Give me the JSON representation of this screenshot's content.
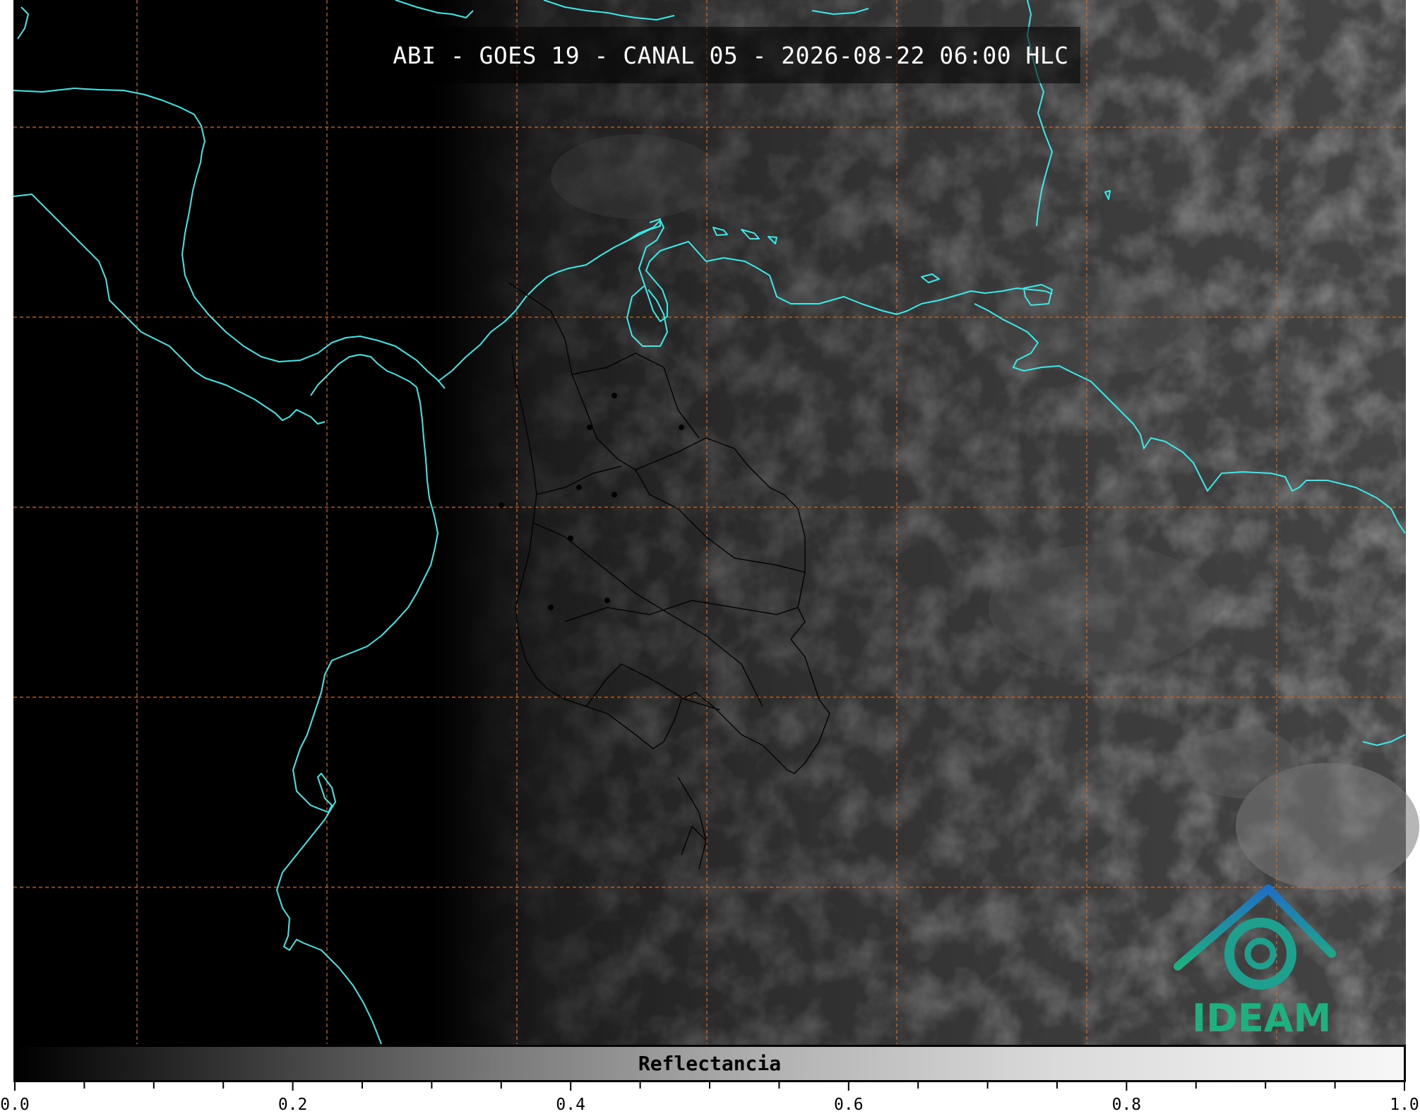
{
  "title": "ABI - GOES 19 - CANAL 05 - 2026-08-22 06:00 HLC",
  "logo": {
    "text": "IDEAM",
    "colors": [
      "#1f7fc4",
      "#1fb07f"
    ]
  },
  "colorbar": {
    "label": "Reflectancia",
    "min": 0.0,
    "max": 1.0,
    "tick_labels": [
      "0.0",
      "0.2",
      "0.4",
      "0.6",
      "0.8",
      "1.0"
    ],
    "colormap": "gray"
  },
  "map": {
    "coastline_color": "#3ee8e8",
    "grid_color": "#d2691e",
    "grid_style": "dashed",
    "border_color": "#000000",
    "background": "#000000"
  }
}
